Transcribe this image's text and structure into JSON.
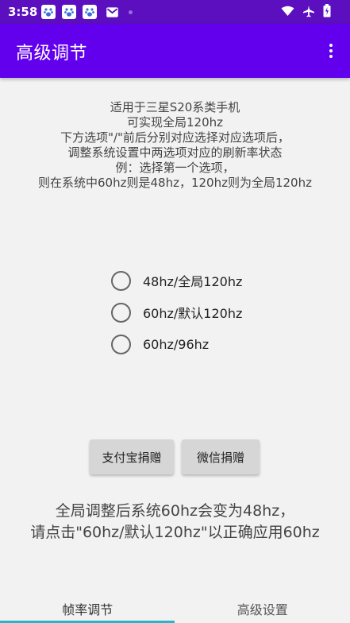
{
  "status_bar": {
    "time": "3:58",
    "notifications": [
      "paw-icon",
      "paw-icon",
      "paw-icon",
      "mail-icon"
    ],
    "right_icons": [
      "wifi-icon",
      "airplane-icon",
      "battery-icon"
    ]
  },
  "app_bar": {
    "title": "高级调节",
    "menu_icon": "more-vert-icon"
  },
  "description": {
    "line1": "适用于三星S20系类手机",
    "line2": "可实现全局120hz",
    "line3": "下方选项\"/\"前后分别对应选择对应选项后，",
    "line4": "调整系统设置中两选项对应的刷新率状态",
    "line5": "例：选择第一个选项，",
    "line6": "则在系统中60hz则是48hz，120hz则为全局120hz"
  },
  "options": [
    {
      "label": "48hz/全局120hz",
      "selected": false
    },
    {
      "label": "60hz/默认120hz",
      "selected": false
    },
    {
      "label": "60hz/96hz",
      "selected": false
    }
  ],
  "buttons": {
    "alipay": "支付宝捐赠",
    "wechat": "微信捐赠"
  },
  "notice": {
    "line1": "全局调整后系统60hz会变为48hz，",
    "line2": "请点击\"60hz/默认120hz\"以正确应用60hz"
  },
  "bottom_nav": {
    "tabs": [
      {
        "label": "帧率调节",
        "active": true
      },
      {
        "label": "高级设置",
        "active": false
      }
    ]
  },
  "colors": {
    "status_bar": "#5b0fbf",
    "app_bar": "#6200ee",
    "tab_indicator": "#29b6c8"
  }
}
